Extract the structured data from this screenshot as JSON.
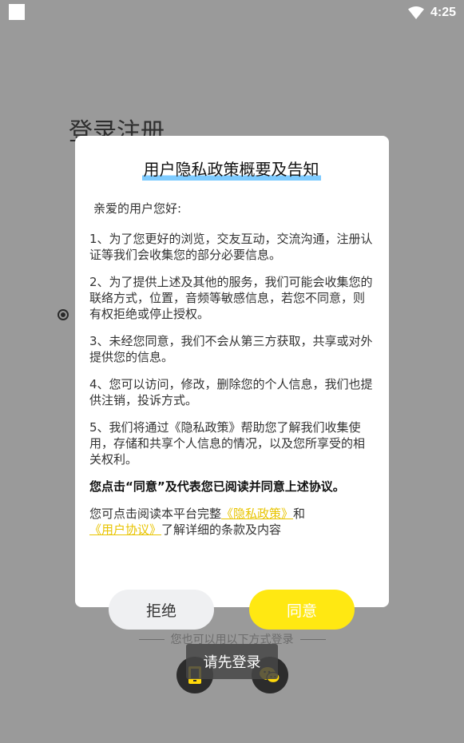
{
  "status_bar": {
    "time": "4:25"
  },
  "background": {
    "title": "登录注册",
    "other_login_text": "您也可以用以下方式登录",
    "toast": "请先登录"
  },
  "dialog": {
    "title": "用户隐私政策概要及告知",
    "greeting": "亲爱的用户您好:",
    "paragraphs": [
      "1、为了您更好的浏览，交友互动，交流沟通，注册认证等我们会收集您的部分必要信息。",
      "2、为了提供上述及其他的服务，我们可能会收集您的联络方式，位置，音频等敏感信息，若您不同意，则有权拒绝或停止授权。",
      "3、未经您同意，我们不会从第三方获取，共享或对外提供您的信息。",
      "4、您可以访问，修改，删除您的个人信息，我们也提供注销，投诉方式。",
      "5、我们将通过《隐私政策》帮助您了解我们收集使用，存储和共享个人信息的情况，以及您所享受的相关权利。"
    ],
    "consent_text": "您点击“同意”及代表您已阅读并同意上述协议。",
    "footer": {
      "prefix": "您可点击阅读本平台完整",
      "privacy_link": "《隐私政策》",
      "conj": "和",
      "user_link": "《用户协议》",
      "suffix": "了解详细的条款及内容"
    }
  },
  "buttons": {
    "reject": "拒绝",
    "agree": "同意"
  },
  "colors": {
    "accent": "#ffe812",
    "link": "#e8c400",
    "title_underline": "#7ecbff"
  }
}
